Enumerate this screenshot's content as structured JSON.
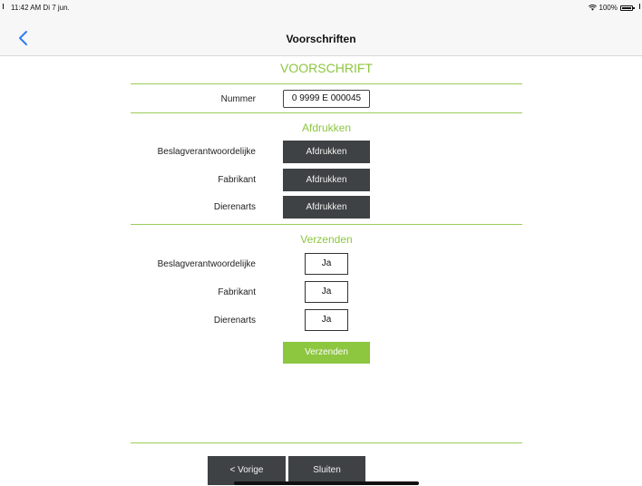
{
  "status_bar": {
    "time": "11:42 AM  Di 7 jun.",
    "battery": "100%"
  },
  "nav": {
    "title": "Voorschriften"
  },
  "main": {
    "title": "VOORSCHRIFT",
    "number": {
      "label": "Nummer",
      "value": "0 9999 E 000045"
    },
    "print_section": {
      "title": "Afdrukken",
      "rows": [
        {
          "label": "Beslagverantwoordelijke",
          "button": "Afdrukken"
        },
        {
          "label": "Fabrikant",
          "button": "Afdrukken"
        },
        {
          "label": "Dierenarts",
          "button": "Afdrukken"
        }
      ]
    },
    "send_section": {
      "title": "Verzenden",
      "rows": [
        {
          "label": "Beslagverantwoordelijke",
          "value": "Ja"
        },
        {
          "label": "Fabrikant",
          "value": "Ja"
        },
        {
          "label": "Dierenarts",
          "value": "Ja"
        }
      ],
      "submit": "Verzenden"
    }
  },
  "footer": {
    "previous": "< Vorige",
    "close": "Sluiten"
  },
  "colors": {
    "accent": "#8dc63f",
    "dark_button": "#3f4244",
    "back_arrow": "#2f7cf6"
  }
}
